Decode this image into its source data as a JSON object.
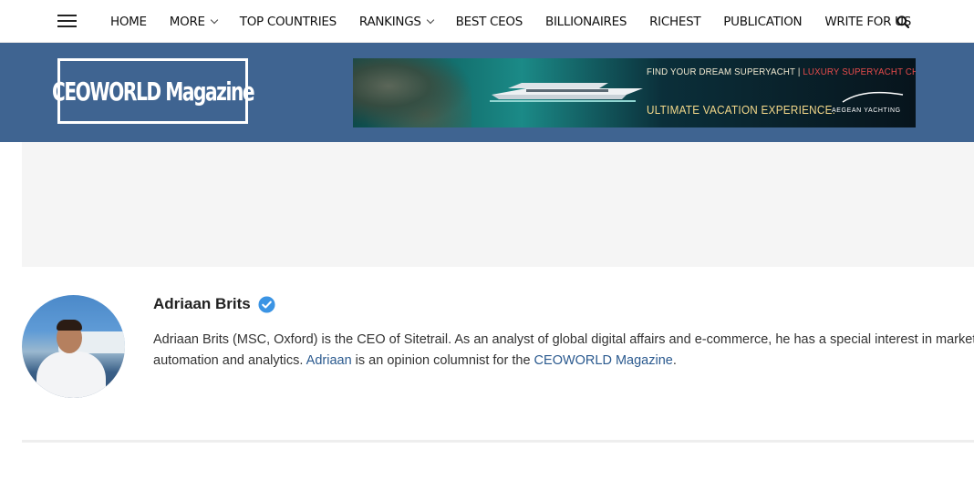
{
  "nav": {
    "items": [
      {
        "label": "HOME",
        "dropdown": false
      },
      {
        "label": "MORE",
        "dropdown": true
      },
      {
        "label": "TOP COUNTRIES",
        "dropdown": false
      },
      {
        "label": "RANKINGS",
        "dropdown": true
      },
      {
        "label": "BEST CEOS",
        "dropdown": false
      },
      {
        "label": "BILLIONAIRES",
        "dropdown": false
      },
      {
        "label": "RICHEST",
        "dropdown": false
      },
      {
        "label": "PUBLICATION",
        "dropdown": false
      },
      {
        "label": "WRITE FOR US",
        "dropdown": false
      }
    ]
  },
  "header": {
    "logo_text": "CEOWORLD Magazine",
    "band_color": "#3f6491"
  },
  "ad": {
    "line1_a": "FIND YOUR DREAM SUPERYACHT | ",
    "line1_b": "LUXURY SUPERYACHT CHARTERS",
    "line2": "ULTIMATE VACATION EXPERIENCE.",
    "brand": "AEGEAN YACHTING"
  },
  "author": {
    "name": "Adriaan Brits",
    "bio_part1": "Adriaan Brits (MSC, Oxford) is the CEO of Sitetrail. As an analyst of global digital affairs and e-commerce, he has a special interest in marketing",
    "bio_part2": "automation and analytics. ",
    "link1": "Adriaan",
    "bio_part3": " is an opinion columnist for the ",
    "link2": "CEOWORLD Magazine",
    "bio_part4": ".",
    "link_color": "#2b5a8f"
  }
}
